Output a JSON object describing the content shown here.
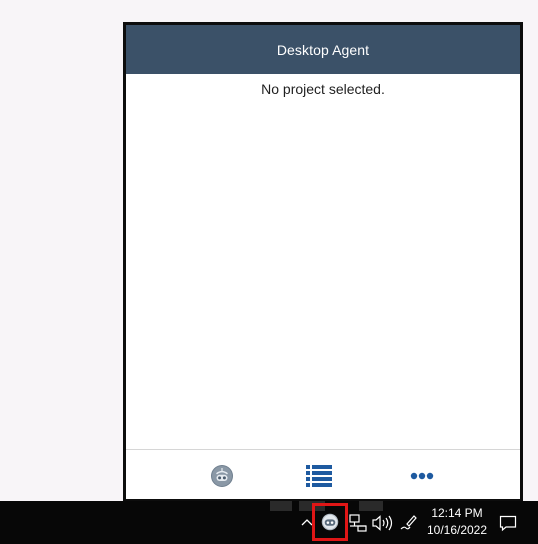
{
  "agent_window": {
    "title": "Desktop Agent",
    "empty_message": "No project selected.",
    "footer": {
      "robot_icon": "robot-icon",
      "list_icon": "list-icon",
      "more_icon": "more-icon"
    }
  },
  "taskbar": {
    "tray_icons": [
      "chevron-up-icon",
      "desktop-agent-icon",
      "network-icon",
      "volume-icon",
      "pen-icon"
    ],
    "clock": {
      "time": "12:14 PM",
      "date": "10/16/2022"
    },
    "notification_icon": "notification-icon"
  },
  "colors": {
    "header": "#3b5168",
    "accent_blue": "#1e5aa0",
    "highlight": "#e01616",
    "taskbar": "#070707"
  }
}
